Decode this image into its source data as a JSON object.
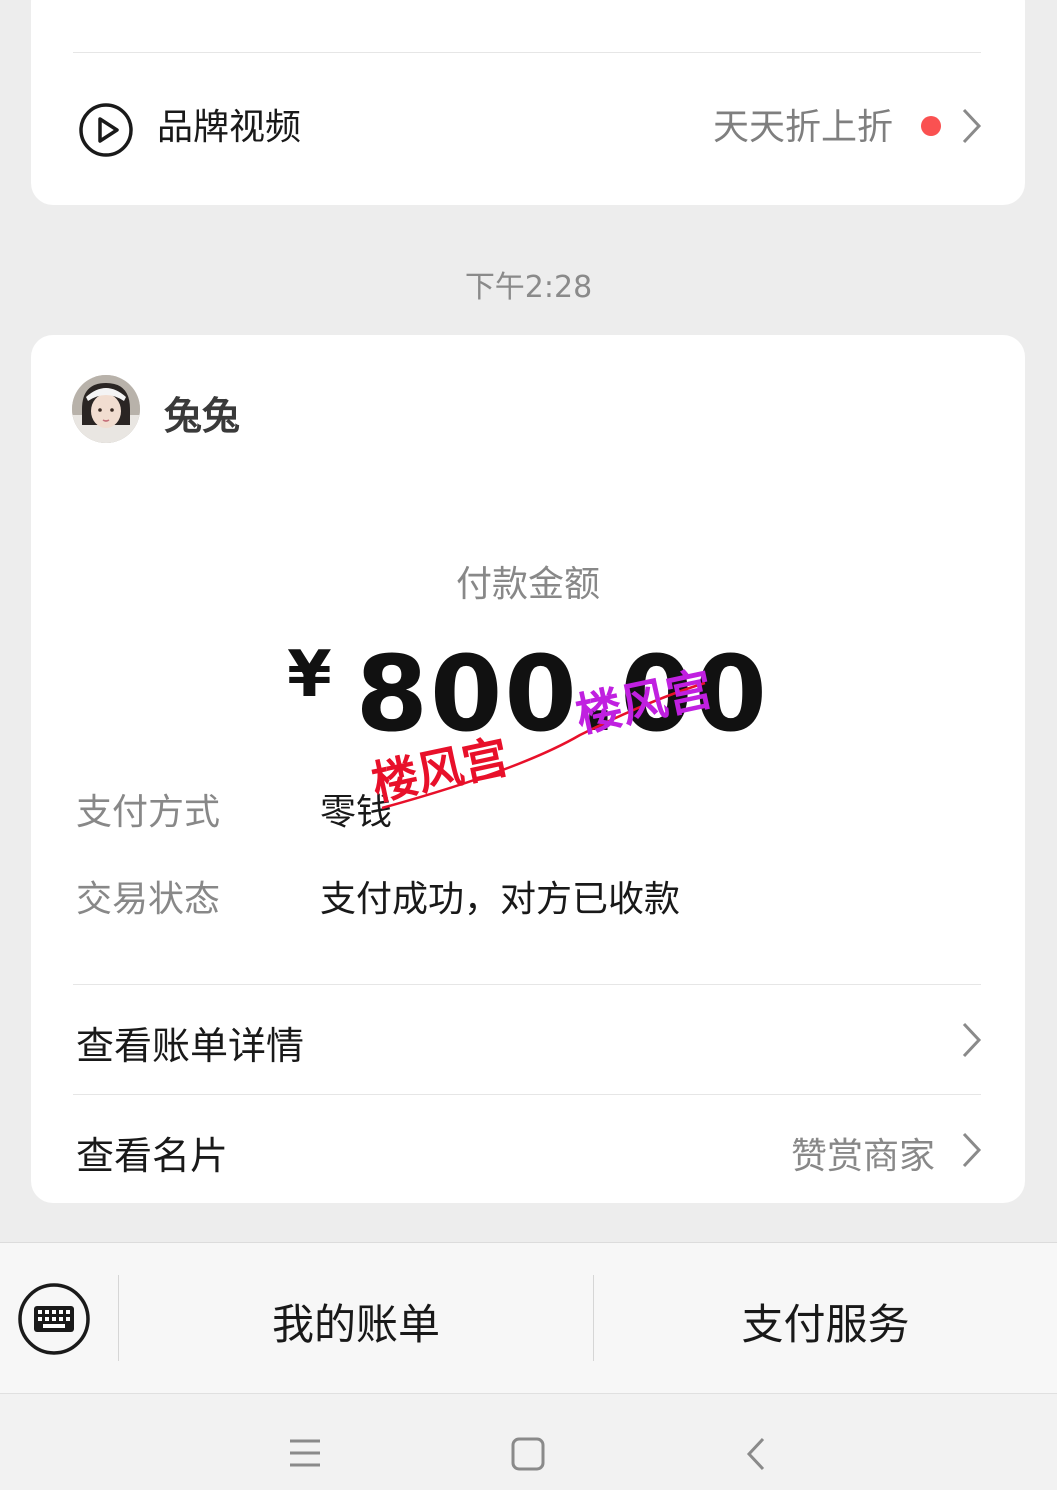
{
  "top_card": {
    "brand_label": "品牌视频",
    "promo_text": "天天折上折",
    "icon": "play-circle-icon"
  },
  "timestamp": "下午2:28",
  "payment_card": {
    "sender_name": "兔兔",
    "amount_label": "付款金额",
    "currency_symbol": "¥",
    "amount": "800.00",
    "details": [
      {
        "key": "支付方式",
        "value": "零钱"
      },
      {
        "key": "交易状态",
        "value": "支付成功，对方已收款"
      }
    ],
    "links": [
      {
        "label": "查看账单详情",
        "extra": ""
      },
      {
        "label": "查看名片",
        "extra": "赞赏商家"
      }
    ]
  },
  "watermark": {
    "text_1": "楼风宫",
    "text_2": "楼风宫"
  },
  "bottom_bar": {
    "keyboard_icon": "keyboard-icon",
    "items": [
      "我的账单",
      "支付服务"
    ]
  },
  "nav_bar": {
    "icons": [
      "menu-icon",
      "home-icon",
      "back-icon"
    ]
  },
  "colors": {
    "background": "#ededed",
    "card": "#ffffff",
    "red_dot": "#fa5151",
    "watermark_red": "#e8102a",
    "watermark_magenta": "#c020e0"
  }
}
